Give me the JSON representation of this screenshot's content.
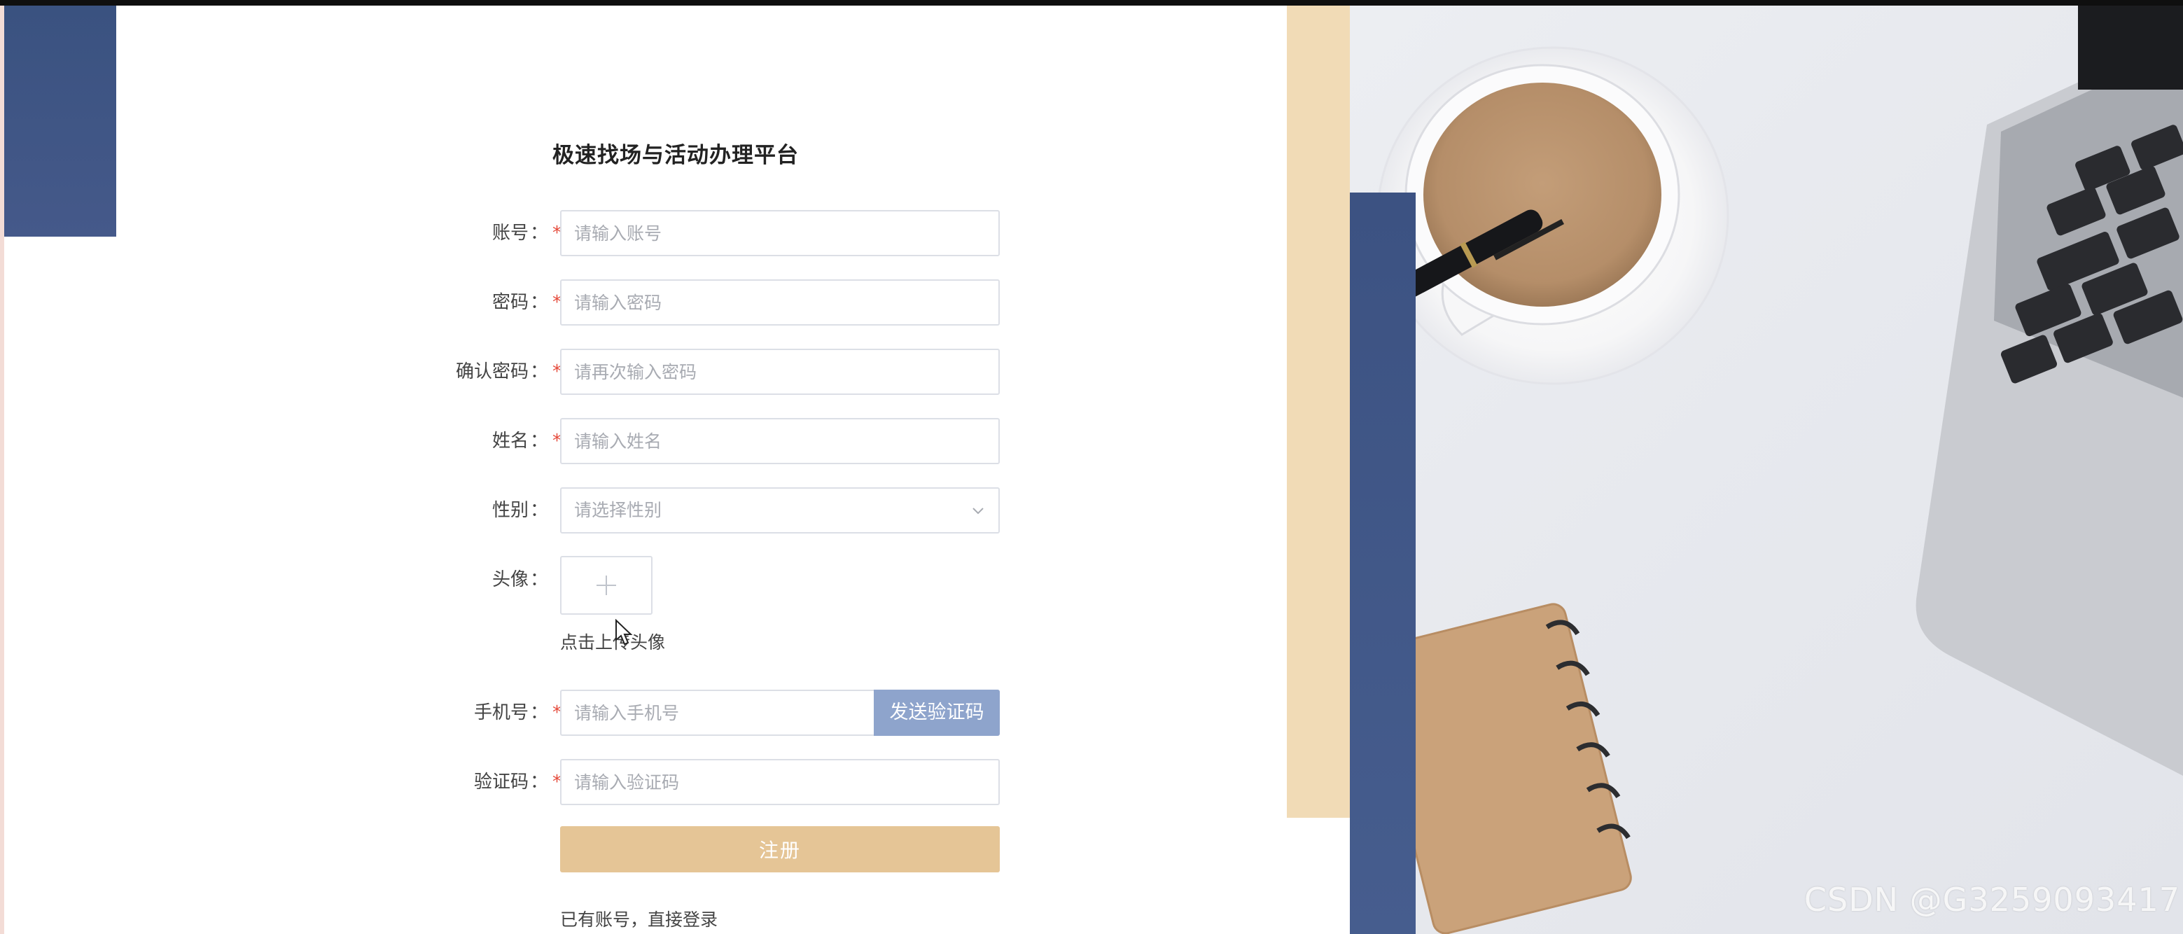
{
  "form": {
    "title": "极速找场与活动办理平台",
    "account": {
      "label": "账号",
      "placeholder": "请输入账号",
      "required": true
    },
    "password": {
      "label": "密码",
      "placeholder": "请输入密码",
      "required": true
    },
    "confirm_password": {
      "label": "确认密码",
      "placeholder": "请再次输入密码",
      "required": true
    },
    "name": {
      "label": "姓名",
      "placeholder": "请输入姓名",
      "required": true
    },
    "gender": {
      "label": "性别",
      "placeholder": "请选择性别",
      "required": false
    },
    "avatar": {
      "label": "头像",
      "hint": "点击上传头像",
      "required": false
    },
    "phone": {
      "label": "手机号",
      "placeholder": "请输入手机号",
      "required": true,
      "send_code_label": "发送验证码"
    },
    "code": {
      "label": "验证码",
      "placeholder": "请输入验证码",
      "required": true
    },
    "submit_label": "注册",
    "login_link": "已有账号，直接登录",
    "required_mark": "*",
    "colon": "："
  },
  "watermark": "CSDN @G3259093417",
  "colors": {
    "accent_blue": "#3d5383",
    "beige": "#f1dbb6",
    "submit": "#e5c596",
    "send_code": "#8ea4cc",
    "required": "#e54b3c"
  },
  "icons": [
    "plus-icon",
    "chevron-down-icon",
    "mouse-cursor-icon"
  ]
}
